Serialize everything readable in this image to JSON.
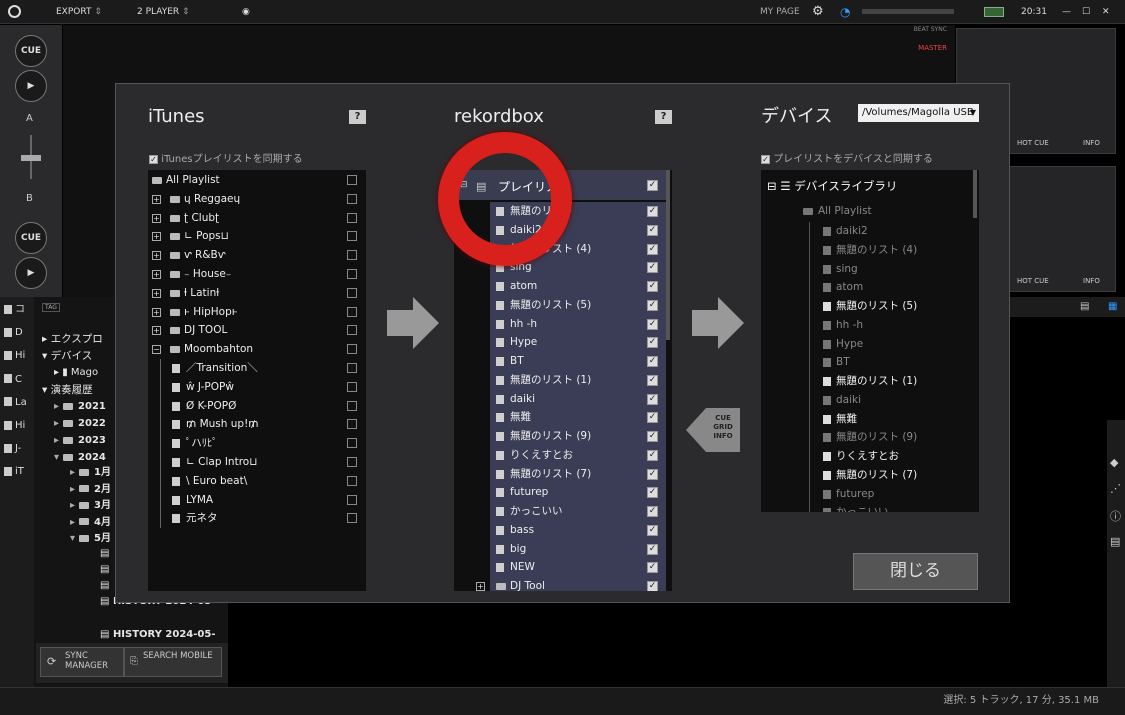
{
  "topbar": {
    "export": "EXPORT",
    "player": "2 PLAYER",
    "my_page": "MY PAGE",
    "time": "20:31"
  },
  "decks": {
    "cue1": "CUE",
    "cue2": "CUE",
    "label_a": "A",
    "label_b": "B",
    "beat_sync": "BEAT SYNC",
    "master": "MASTER",
    "hot_cue": "HOT CUE",
    "info": "INFO",
    "hot_cue2": "HOT CUE",
    "info2": "INFO"
  },
  "sidebar": {
    "left_icons": [
      "コ",
      "D",
      "Hi",
      "C",
      "La",
      "Hi",
      "J-",
      "iT"
    ],
    "explorer": "エクスプロ",
    "devices": "デバイス",
    "mago": "Mago",
    "history": "演奏履歴",
    "years": [
      "2021",
      "2022",
      "2023",
      "2024"
    ],
    "months": [
      "1月",
      "2月",
      "3月",
      "4月",
      "5月"
    ],
    "hist": [
      "HISTORY 2024-05-",
      "HISTORY 2024-05-"
    ],
    "tag": "TAG"
  },
  "bottom": {
    "sync": "SYNC MANAGER",
    "search": "SEARCH MOBILE",
    "status": "選択: 5 トラック, 17 分, 35.1 MB"
  },
  "modal": {
    "itunes_title": "iTunes",
    "rekordbox_title": "rekordbox",
    "devices_title": "デバイス",
    "help": "?",
    "device_path": "/Volumes/Magolla USB",
    "sync_itunes": "iTunesプレイリストを同期する",
    "sync_device": "プレイリストをデバイスと同期する",
    "cue_grid_info": "CUE GRID INFO",
    "close": "閉じる",
    "itunes_list": [
      "All Playlist",
      "ɥ Reggaeɥ",
      "ʈ Clubʈ",
      "∟ Pops⊔",
      "ⱱ R&Bⱱ",
      "₋ House₋",
      "ƚ Latinƚ",
      "ⱶ HipHopⱶ",
      "DJ TOOL",
      "Moombahton",
      "／Transition＼",
      "ŵ J-POPŵ",
      "Ø K-POPØ",
      "₥ Mush up!₥",
      "ﾟハﾘﾋﾟ",
      "∟ Clap Intro⊔",
      "\\ Euro beat\\",
      "LYMA",
      "元ネタ"
    ],
    "rb_root": "プレイリスト",
    "rb_list": [
      "無題のリスト",
      "daiki2",
      "無題のリスト (4)",
      "sing",
      "atom",
      "無題のリスト (5)",
      "hh -h",
      "Hype",
      "BT",
      "無題のリスト (1)",
      "daiki",
      "無難",
      "無題のリスト (9)",
      "りくえすとお",
      "無題のリスト (7)",
      "futurep",
      "かっこいい",
      "bass",
      "big",
      "NEW",
      "DJ Tool"
    ],
    "dev_root": "デバイスライブラリ",
    "dev_all": "All Playlist",
    "dev_list": [
      "daiki2",
      "無題のリスト (4)",
      "sing",
      "atom",
      "無題のリスト (5)",
      "hh -h",
      "Hype",
      "BT",
      "無題のリスト (1)",
      "daiki",
      "無難",
      "無題のリスト (9)",
      "りくえすとお",
      "無題のリスト (7)",
      "futurep",
      "かっこいい"
    ],
    "dev_bright": [
      false,
      false,
      false,
      false,
      true,
      false,
      false,
      false,
      true,
      false,
      true,
      false,
      true,
      true,
      false,
      false
    ]
  }
}
